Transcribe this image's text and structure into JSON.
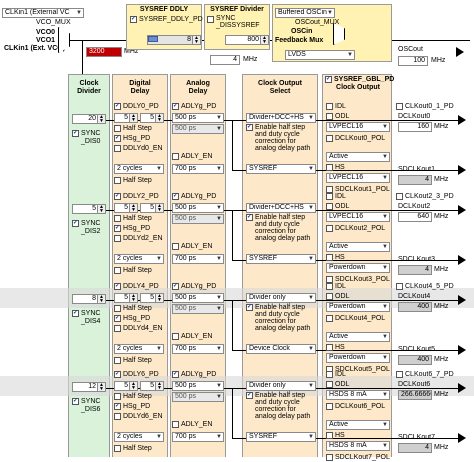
{
  "top": {
    "clkin_select": "CLKin1 (External VC",
    "vco_mux": "VCO_MUX",
    "vco0": "VCO0",
    "vco1": "VCO1",
    "clkin1_ext": "CLKin1 (Ext. VCO)",
    "freq_value": "3200",
    "freq_unit": "MHz",
    "sysref_ddly_title": "SYSREF DDLY",
    "sysref_ddly_pd": "SYSREF_DDLY_PD",
    "sysref_ddly_value": "8",
    "sysref_divider_title": "SYSREF Divider",
    "sync_dissysref": "SYNC _DISSYSREF",
    "sysref_div_value": "800",
    "sysref_freq": "4",
    "sysref_freq_unit": "MHz",
    "oscin_select": "Buffered OSCin",
    "oscout_mux": "OSCout_MUX",
    "oscin": "OSCin",
    "feedback_mux": "Feedback Mux",
    "oscout_fmt": "LVDS",
    "oscout_label": "OSCout",
    "oscout_freq": "100",
    "oscout_unit": "MHz"
  },
  "headers": {
    "clock_divider": "Clock Divider",
    "digital_delay": "Digital Delay",
    "analog_delay": "Analog Delay",
    "clock_output_select": "Clock Output Select",
    "gbl_pd": "SYSREF_GBL_PD",
    "clock_output": "Clock Output"
  },
  "groups": [
    {
      "div_value": "20",
      "sync": "SYNC _DIS0",
      "ddly_a": "5",
      "ddly_b": "5",
      "ddly_pd": "DDLY0_PD",
      "hs_pd": "HSg_PD",
      "half_step": "Half Step",
      "dlyd_en": "DDLYd0_EN",
      "adly_pd": "ADLYg_PD",
      "adly_a": "500 ps",
      "adly_b": "500 ps",
      "adly_en": "ADLY_EN",
      "cycles": "2 cycles",
      "adly_c": "700 ps",
      "half_step2": "Half Step",
      "out_sel_a": "Divider+DCC+HS",
      "enable_text": "Enable half step and duty cycle correction for analog delay path",
      "out_sel_b": "SYSREF",
      "idl": "IDL",
      "odl": "ODL",
      "fmt_a": "LVPECL16",
      "pol_a": "DCLKout0_POL",
      "out_a_label": "DCLKout0",
      "out_a_freq": "160",
      "out_a_pd": "CLKout0_1_PD",
      "state": "Active",
      "hs_b": "HS",
      "fmt_b": "LVPECL16",
      "pol_b": "SDCLKout1_POL",
      "out_b_label": "SDCLKout1",
      "out_b_freq": "4",
      "unit": "MHz"
    },
    {
      "div_value": "5",
      "sync": "SYNC _DIS2",
      "ddly_a": "5",
      "ddly_b": "5",
      "ddly_pd": "DDLY2_PD",
      "hs_pd": "HSg_PD",
      "half_step": "Half Step",
      "dlyd_en": "DDLYd2_EN",
      "adly_pd": "ADLYg_PD",
      "adly_a": "500 ps",
      "adly_b": "500 ps",
      "adly_en": "ADLY_EN",
      "cycles": "2 cycles",
      "adly_c": "700 ps",
      "half_step2": "Half Step",
      "out_sel_a": "Divider+DCC+HS",
      "enable_text": "Enable half step and duty cycle correction for analog delay path",
      "out_sel_b": "SYSREF",
      "idl": "IDL",
      "odl": "ODL",
      "fmt_a": "LVPECL16",
      "pol_a": "DCLKout2_POL",
      "out_a_label": "DCLKout2",
      "out_a_freq": "640",
      "out_a_pd": "CLKout2_3_PD",
      "state": "Active",
      "hs_b": "HS",
      "fmt_b": "Powerdown",
      "pol_b": "SDCLKout3_POL",
      "out_b_label": "SDCLKout3",
      "out_b_freq": "4",
      "unit": "MHz"
    },
    {
      "div_value": "8",
      "sync": "SYNC _DIS4",
      "ddly_a": "5",
      "ddly_b": "5",
      "ddly_pd": "DDLY4_PD",
      "hs_pd": "HSg_PD",
      "half_step": "Half Step",
      "dlyd_en": "DDLYd4_EN",
      "adly_pd": "ADLYg_PD",
      "adly_a": "500 ps",
      "adly_b": "500 ps",
      "adly_en": "ADLY_EN",
      "cycles": "2 cycles",
      "adly_c": "700 ps",
      "half_step2": "Half Step",
      "out_sel_a": "Divider only",
      "enable_text": "Enable half step and duty cycle correction for analog delay path",
      "out_sel_b": "Device Clock",
      "idl": "IDL",
      "odl": "ODL",
      "fmt_a": "Powerdown",
      "pol_a": "DCLKout4_POL",
      "out_a_label": "DCLKout4",
      "out_a_freq": "400",
      "out_a_pd": "CLKout4_5_PD",
      "state": "Active",
      "hs_b": "HS",
      "fmt_b": "Powerdown",
      "pol_b": "SDCLKout5_POL",
      "out_b_label": "SDCLKout5",
      "out_b_freq": "400",
      "unit": "MHz"
    },
    {
      "div_value": "12",
      "sync": "SYNC _DIS6",
      "ddly_a": "5",
      "ddly_b": "5",
      "ddly_pd": "DDLY6_PD",
      "hs_pd": "HSg_PD",
      "half_step": "Half Step",
      "dlyd_en": "DDLYd6_EN",
      "adly_pd": "ADLYg_PD",
      "adly_a": "500 ps",
      "adly_b": "500 ps",
      "adly_en": "ADLY_EN",
      "cycles": "2 cycles",
      "adly_c": "700 ps",
      "half_step2": "Half Step",
      "out_sel_a": "Divider only",
      "enable_text": "Enable half step and duty cycle correction for analog delay path",
      "out_sel_b": "SYSREF",
      "idl": "IDL",
      "odl": "ODL",
      "fmt_a": "HSDS 8 mA",
      "pol_a": "DCLKout6_POL",
      "out_a_label": "DCLKout6",
      "out_a_freq": "266.66666",
      "out_a_pd": "CLKout6_7_PD",
      "state": "Active",
      "hs_b": "HS",
      "fmt_b": "HSDS 8 mA",
      "pol_b": "SDCLKout7_POL",
      "out_b_label": "SDCLKout7",
      "out_b_freq": "4",
      "unit": "MHz"
    }
  ],
  "colors": {
    "panel_yellow": "#fff2b3",
    "panel_green": "#d9f2d9",
    "panel_peach": "#fde9c9",
    "freq_red": "#c00000",
    "band_gray": "#d9d9d9"
  }
}
